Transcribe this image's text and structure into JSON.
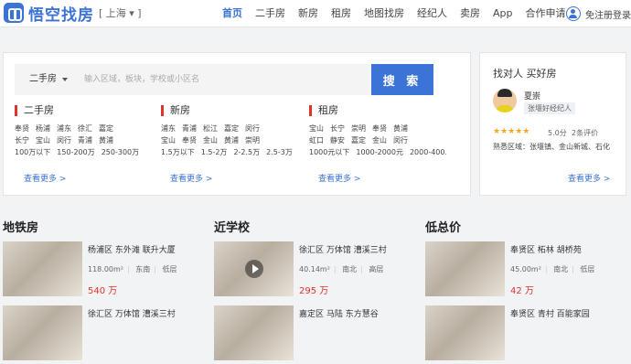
{
  "header": {
    "logo_text": "悟空找房",
    "city": "[ 上海 ▾ ]",
    "nav": [
      "首页",
      "二手房",
      "新房",
      "租房",
      "地图找房",
      "经纪人",
      "卖房",
      "App",
      "合作申请"
    ],
    "login": "免注册登录"
  },
  "search": {
    "type": "二手房",
    "placeholder": "输入区域，板块，学校或小区名",
    "button": "搜 索"
  },
  "categories": [
    {
      "title": "二手房",
      "rows": [
        [
          "奉贤",
          "杨浦",
          "浦东",
          "徐汇",
          "嘉定"
        ],
        [
          "长宁",
          "宝山",
          "闵行",
          "青浦",
          "黄浦"
        ],
        [
          "100万以下",
          "150-200万",
          "250-300万"
        ]
      ],
      "more": "查看更多 >"
    },
    {
      "title": "新房",
      "rows": [
        [
          "浦东",
          "青浦",
          "松江",
          "嘉定",
          "闵行"
        ],
        [
          "宝山",
          "奉贤",
          "金山",
          "黄浦",
          "崇明"
        ],
        [
          "1.5万以下",
          "1.5-2万",
          "2-2.5万",
          "2.5-3万"
        ]
      ],
      "more": "查看更多 >"
    },
    {
      "title": "租房",
      "rows": [
        [
          "宝山",
          "长宁",
          "崇明",
          "奉贤",
          "黄浦"
        ],
        [
          "虹口",
          "静安",
          "嘉定",
          "金山",
          "闵行"
        ],
        [
          "1000元以下",
          "1000-2000元",
          "2000-400..."
        ]
      ],
      "more": "查看更多 >"
    }
  ],
  "agent": {
    "title": "找对人 买好房",
    "name": "夏崇",
    "badge": "张堰好经纪人",
    "stars": "★★★★★",
    "rating": "5.0分",
    "reviews": "2条评价",
    "areas": "熟悉区域：张堰镇、金山新城、石化",
    "more": "查看更多 >"
  },
  "sections": [
    {
      "title": "地铁房",
      "listings": [
        {
          "title": "杨浦区 东外滩 联升大厦",
          "area": "118.00m²",
          "orientation": "东南",
          "floor": "低层",
          "price": "540 万",
          "video": false
        },
        {
          "title": "徐汇区 万体馆 漕溪三村",
          "area": "",
          "orientation": "",
          "floor": "",
          "price": "",
          "video": false
        }
      ]
    },
    {
      "title": "近学校",
      "listings": [
        {
          "title": "徐汇区 万体馆 漕溪三村",
          "area": "40.14m²",
          "orientation": "南北",
          "floor": "高层",
          "price": "295 万",
          "video": true
        },
        {
          "title": "嘉定区 马陆 东方慧谷",
          "area": "",
          "orientation": "",
          "floor": "",
          "price": "",
          "video": false
        }
      ]
    },
    {
      "title": "低总价",
      "listings": [
        {
          "title": "奉贤区 柘林 胡桥苑",
          "area": "45.00m²",
          "orientation": "南北",
          "floor": "低层",
          "price": "42 万",
          "video": false
        },
        {
          "title": "奉贤区 青村 百能家园",
          "area": "",
          "orientation": "",
          "floor": "",
          "price": "",
          "video": false
        }
      ]
    }
  ]
}
